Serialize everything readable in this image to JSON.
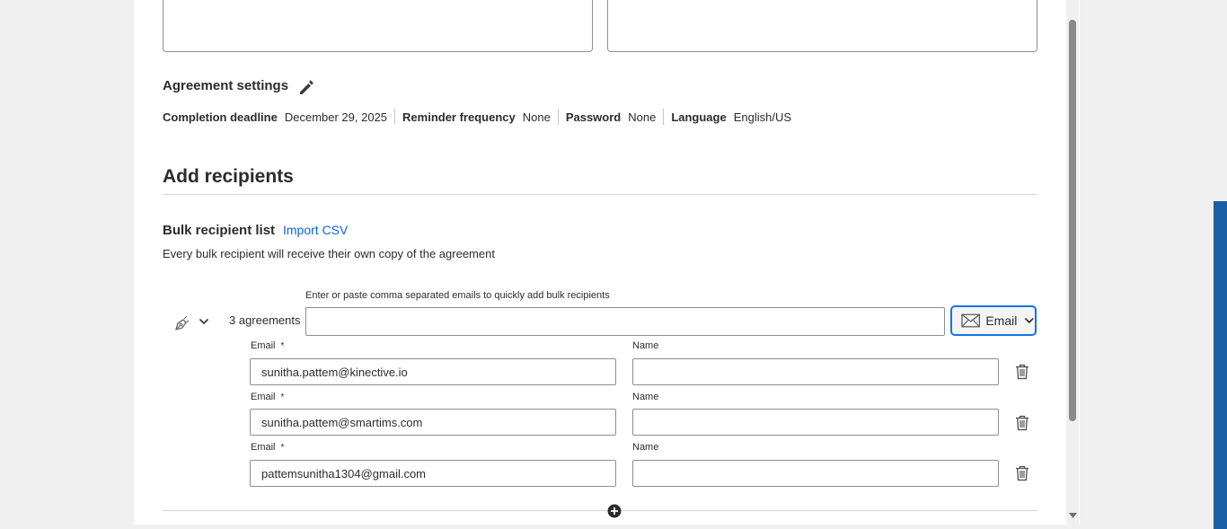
{
  "settings": {
    "title": "Agreement settings",
    "items": [
      {
        "label": "Completion deadline",
        "value": "December 29, 2025"
      },
      {
        "label": "Reminder frequency",
        "value": "None"
      },
      {
        "label": "Password",
        "value": "None"
      },
      {
        "label": "Language",
        "value": "English/US"
      }
    ]
  },
  "recipients": {
    "title": "Add recipients",
    "bulk_title": "Bulk recipient list",
    "import_label": "Import CSV",
    "description": "Every bulk recipient will receive their own copy of the agreement",
    "hint": "Enter or paste comma separated emails to quickly add bulk recipients",
    "bulk_input_value": "",
    "count_label": "3 agreements",
    "delivery_method": "Email",
    "email_label": "Email",
    "required_mark": "*",
    "name_label": "Name",
    "rows": [
      {
        "email": "sunitha.pattem@kinective.io",
        "name": ""
      },
      {
        "email": "sunitha.pattem@smartims.com",
        "name": ""
      },
      {
        "email": "pattemsunitha1304@gmail.com",
        "name": ""
      }
    ]
  },
  "icons": {
    "edit": "pencil-icon",
    "signer": "pen-nib-icon",
    "expand": "chevron-down-icon",
    "delivery": "envelope-icon",
    "delete": "trash-icon",
    "add": "plus-circle-icon"
  },
  "colors": {
    "accent": "#1473e6",
    "link": "#0d66d0",
    "side_bar": "#1a5fa8"
  }
}
